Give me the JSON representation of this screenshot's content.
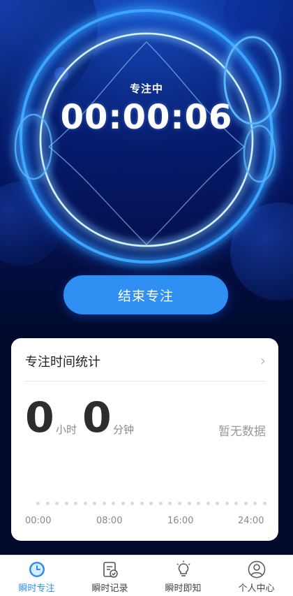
{
  "focus": {
    "status_label": "专注中",
    "timer": "00:00:06",
    "end_button_label": "结束专注"
  },
  "stats": {
    "title": "专注时间统计",
    "hours_value": "0",
    "hours_unit": "小时",
    "minutes_value": "0",
    "minutes_unit": "分钟",
    "no_data_label": "暂无数据",
    "ticks": [
      "00:00",
      "08:00",
      "16:00",
      "24:00"
    ]
  },
  "tabbar": {
    "items": [
      {
        "label": "瞬时专注",
        "icon": "clock-icon",
        "active": true
      },
      {
        "label": "瞬时记录",
        "icon": "record-icon",
        "active": false
      },
      {
        "label": "瞬时即知",
        "icon": "bulb-icon",
        "active": false
      },
      {
        "label": "个人中心",
        "icon": "user-icon",
        "active": false
      }
    ]
  },
  "colors": {
    "accent": "#2f8ff3",
    "active_tab": "#2a8ef2",
    "ring_glow": "#3aa6ff"
  }
}
